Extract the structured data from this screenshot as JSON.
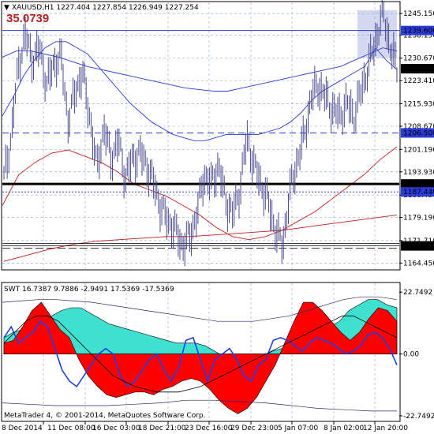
{
  "header": {
    "arrow": "▼",
    "symbol_info": "XAUUSD,H1  1227.404 1227.854 1226.949 1227.254",
    "overlay_value": "35.0739"
  },
  "indicator_header": "SWT 16.7387 9.7886 -2.9491 17.5369 -17.5369",
  "copyright": "MetaTrader 4, © 2001-2014, MetaQuotes Software Corp.",
  "colors": {
    "grid": "#9ab3d2",
    "price_line": "#4b4b8f",
    "ma_blue": "#2b3bd6",
    "ma_red": "#c41d1d",
    "cyan_fill": "#40e0d0",
    "red_fill": "#ff0000",
    "overlay_red": "#b22222",
    "highlight_box": "#d4d8f0"
  },
  "chart_data": [
    {
      "type": "line",
      "title": "XAUUSD,H1",
      "y_ticks": [
        1245.1,
        1238.15,
        1230.67,
        1223.41,
        1215.93,
        1208.67,
        1201.19,
        1193.93,
        1186.45,
        1179.19,
        1171.71,
        1164.45
      ],
      "y_tick_labels": [
        "1245.150",
        "1238.150",
        "1230.670",
        "1223.410",
        "1215.930",
        "1208.670",
        "1201.190",
        "1193.930",
        "1186.450",
        "1179.190",
        "1171.710",
        "1164.450"
      ],
      "ylim": [
        1162.5,
        1248.7
      ],
      "x_tick_labels": [
        "8 Dec 2014",
        "11 Dec 08:00",
        "16 Dec 03:00",
        "18 Dec 21:00",
        "23 Dec 16:00",
        "29 Dec 23:00",
        "5 Jan 07:00",
        "8 Jan 02:00",
        "12 Jan 20:00"
      ],
      "horizontal_levels": [
        {
          "value": 1239.6,
          "label": "1239.600",
          "style": "solid"
        },
        {
          "value": 1206.5,
          "label": "1206.500",
          "style": "dashed"
        },
        {
          "value": 1190.0,
          "label": "1190.000",
          "style": "bold"
        },
        {
          "value": 1187.44,
          "label": "1187.440",
          "style": "dotted"
        },
        {
          "value": 1170.0,
          "label": "1170.000",
          "style": "double"
        }
      ],
      "current_price": {
        "value": 1227.254,
        "label": "1227.254"
      },
      "series": [
        {
          "role": "price",
          "values": [
            1192,
            1205,
            1228,
            1238,
            1230,
            1234,
            1222,
            1229,
            1231,
            1210,
            1220,
            1226,
            1212,
            1195,
            1208,
            1198,
            1204,
            1192,
            1198,
            1200,
            1196,
            1190,
            1182,
            1178,
            1175,
            1170,
            1173,
            1180,
            1193,
            1190,
            1196,
            1185,
            1180,
            1188,
            1205,
            1196,
            1190,
            1184,
            1175,
            1170,
            1187,
            1197,
            1205,
            1218,
            1222,
            1218,
            1214,
            1212,
            1216,
            1212,
            1220,
            1228,
            1236,
            1246,
            1235,
            1227
          ]
        },
        {
          "role": "ma-fast",
          "values": [
            1212,
            1218,
            1225,
            1230,
            1234,
            1236,
            1236,
            1234,
            1232,
            1228,
            1224,
            1220,
            1216,
            1213,
            1210,
            1208,
            1206,
            1205,
            1204,
            1204,
            1205,
            1206,
            1206,
            1206,
            1206,
            1207,
            1208,
            1210,
            1213,
            1217,
            1220,
            1222,
            1224,
            1226,
            1228,
            1234,
            1230,
            1227
          ]
        },
        {
          "role": "ma-slow",
          "values": [
            1231,
            1233,
            1233,
            1232,
            1231,
            1229.5,
            1228,
            1227,
            1226,
            1225,
            1224,
            1223,
            1222,
            1221,
            1220.5,
            1220,
            1220,
            1221,
            1222,
            1223,
            1224,
            1225,
            1226,
            1227,
            1228,
            1230,
            1232,
            1234,
            1233
          ]
        },
        {
          "role": "ma-red-mid",
          "values": [
            1183,
            1193,
            1197,
            1200,
            1201,
            1199,
            1197,
            1194,
            1190,
            1188,
            1186,
            1183,
            1180,
            1176,
            1173,
            1172,
            1173,
            1175,
            1178,
            1181,
            1185,
            1189,
            1193,
            1198,
            1202
          ]
        },
        {
          "role": "ma-red-slow",
          "values": [
            1165,
            1167,
            1169,
            1170.5,
            1171.5,
            1172,
            1172.5,
            1173,
            1173,
            1173.5,
            1174,
            1174.5,
            1175,
            1176,
            1177,
            1178,
            1179,
            1180
          ]
        }
      ]
    },
    {
      "type": "area",
      "title": "SWT",
      "values_header": [
        16.7387,
        9.7886,
        -2.9491,
        17.5369,
        -17.5369
      ],
      "y_ticks": [
        22.7492,
        0.0,
        -22.7492
      ],
      "y_tick_labels": [
        "22.7492",
        "0.00",
        "-22.7492"
      ],
      "ylim": [
        -24.5,
        26.0
      ],
      "series": [
        {
          "role": "cyan-band",
          "values": [
            6,
            8,
            9,
            10,
            12,
            14,
            16,
            17,
            17,
            15,
            13,
            11,
            10,
            9,
            8,
            7,
            6,
            5,
            4,
            4,
            4,
            3,
            1,
            -1,
            -2,
            -3,
            -2,
            -1,
            1,
            2,
            2,
            4,
            6,
            8,
            10,
            12,
            16,
            18,
            20,
            20,
            18,
            17
          ]
        },
        {
          "role": "red-band",
          "values": [
            4,
            5,
            10,
            16,
            19,
            14,
            9,
            6,
            -2,
            -8,
            -12,
            -15,
            -16,
            -15,
            -14,
            -14,
            -15,
            -13,
            -12,
            -10,
            -9,
            -10,
            -13,
            -17,
            -20,
            -22,
            -20,
            -16,
            -10,
            -4,
            4,
            12,
            19,
            19,
            16,
            12,
            8,
            5,
            8,
            13,
            17,
            16,
            12
          ]
        },
        {
          "role": "blue-line",
          "values": [
            6,
            10,
            4,
            6,
            8,
            12,
            10,
            2,
            -6,
            -10,
            -12,
            -8,
            -4,
            0,
            2,
            0,
            -8,
            -12,
            -10,
            -6,
            -2,
            0,
            -6,
            -10,
            -5,
            5,
            6,
            -2,
            -10,
            -2,
            0,
            2,
            -2,
            -8,
            -10,
            -4,
            -2,
            5,
            6,
            5,
            3,
            1,
            4,
            6,
            5,
            4,
            2,
            0,
            1,
            3,
            7,
            8,
            6,
            2,
            -4
          ]
        },
        {
          "role": "dark-line",
          "values": [
            4,
            8,
            12,
            14,
            14,
            12,
            8,
            4,
            0,
            -4,
            -8,
            -10,
            -12,
            -13,
            -14,
            -14,
            -14,
            -13,
            -12,
            -10,
            -8,
            -6,
            -4,
            -2,
            0,
            2,
            4,
            6,
            8,
            10,
            12,
            14,
            14,
            12,
            10,
            8,
            6
          ]
        },
        {
          "role": "upper-envelope",
          "values": [
            19,
            19.5,
            20,
            20,
            19.5,
            19,
            18,
            17,
            16,
            15,
            14,
            13,
            12,
            12,
            12,
            13,
            14,
            16,
            18,
            20,
            21,
            21,
            20
          ]
        },
        {
          "role": "lower-envelope",
          "values": [
            -18,
            -18.5,
            -19,
            -19,
            -19,
            -18.5,
            -18,
            -17,
            -17,
            -17.5,
            -18,
            -19,
            -20,
            -20.5,
            -21,
            -21
          ]
        }
      ]
    }
  ]
}
